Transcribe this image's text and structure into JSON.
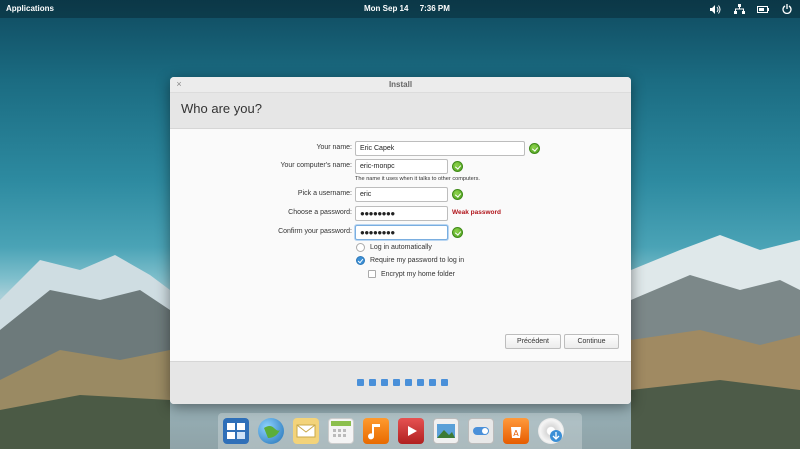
{
  "panel": {
    "applications_label": "Applications",
    "date": "Mon Sep 14",
    "time": "7:36 PM",
    "indicators": [
      "volume-icon",
      "network-icon",
      "battery-icon",
      "power-icon"
    ]
  },
  "window": {
    "title": "Install",
    "close_glyph": "×",
    "page_title": "Who are you?"
  },
  "form": {
    "name_label": "Your name:",
    "name_value": "Eric Capek",
    "computer_label": "Your computer's name:",
    "computer_value": "eric-monpc",
    "computer_hint": "The name it uses when it talks to other computers.",
    "username_label": "Pick a username:",
    "username_value": "eric",
    "password_label": "Choose a password:",
    "password_value": "●●●●●●●●",
    "password_strength": "Weak password",
    "confirm_label": "Confirm your password:",
    "confirm_value": "●●●●●●●●",
    "option_auto_login": "Log in automatically",
    "option_require_password": "Require my password to log in",
    "option_encrypt_home": "Encrypt my home folder",
    "selected_option": "Require my password to log in",
    "encrypt_checked": false
  },
  "buttons": {
    "back": "Précédent",
    "continue": "Continue"
  },
  "progress": {
    "total_steps": 8
  },
  "dock": {
    "items": [
      "multitasking-view-icon",
      "web-browser-icon",
      "mail-icon",
      "calendar-icon",
      "music-icon",
      "videos-icon",
      "photos-icon",
      "switchboard-icon",
      "appcenter-icon",
      "installer-icon"
    ]
  },
  "colors": {
    "accent": "#4a90d9",
    "valid_green": "#4a9e1c",
    "weak_red": "#b0141a"
  }
}
